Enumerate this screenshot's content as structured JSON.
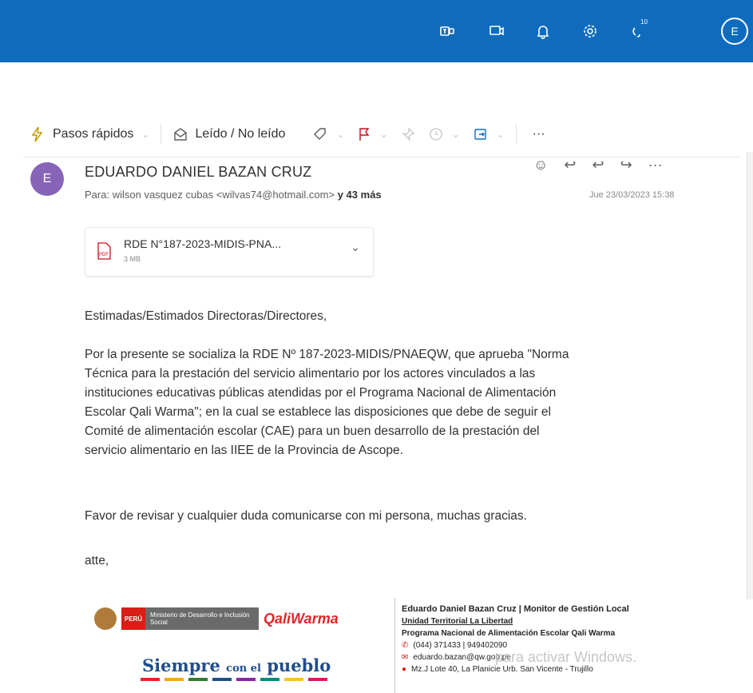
{
  "topbar": {
    "icons": [
      "teams-icon",
      "meet-now-icon",
      "bell-icon",
      "gear-icon",
      "tips-icon"
    ],
    "tips_badge": "10",
    "avatar_initial": "E"
  },
  "toolbar": {
    "quick_steps": "Pasos rápidos",
    "read_unread": "Leído / No leído",
    "more": "···"
  },
  "email": {
    "sender_initial": "E",
    "sender": "EDUARDO DANIEL BAZAN CRUZ",
    "to_prefix": "Para:",
    "to_value": "wilson vasquez cubas <wilvas74@hotmail.com>",
    "to_more": "y 43 más",
    "date": "Jue 23/03/2023 15:38",
    "attachment_name": "RDE N°187-2023-MIDIS-PNA...",
    "attachment_size": "3 MB",
    "greeting": "Estimadas/Estimados Directoras/Directores,",
    "paragraph_lines": [
      "Por la presente se socializa la RDE Nº 187-2023-MIDIS/PNAEQW, que aprueba \"Norma",
      "Técnica para la prestación del servicio alimentario por los actores vinculados a las",
      "instituciones educativas públicas atendidas por el Programa Nacional de Alimentación",
      "Escolar Qali Warma\"; en la cual se establece las disposiciones que debe de seguir el",
      "Comité de alimentación escolar (CAE) para un buen desarrollo de la prestación del",
      "servicio alimentario en las IIEE de la Provincia de Ascope."
    ],
    "closing": "Favor de revisar y cualquier duda comunicarse con mi persona, muchas gracias.",
    "signoff": "atte,"
  },
  "signature": {
    "peru": "PERÚ",
    "ministry": "Ministerio de Desarrollo e Inclusión Social",
    "brand": "QaliWarma",
    "slogan_a": "Siempre",
    "slogan_b": "con el",
    "slogan_c": "pueblo",
    "line1": "Eduardo Daniel Bazan Cruz | Monitor de Gestión Local",
    "line2": "Unidad Territorial La Libertad",
    "line3": "Programa Nacional de Alimentación Escolar Qali Warma",
    "phone": "(044) 371433 | 949402090",
    "email": "eduardo.bazan@qw.gob.pe",
    "address": "Mz.J Lote 40, La Planicie Urb. San Vicente - Trujillo",
    "stripe_colors": [
      "#e3262b",
      "#f5a623",
      "#2e7d32",
      "#1f4e8c",
      "#8e24aa",
      "#00897b",
      "#fbc02d",
      "#d81b60"
    ]
  },
  "watermark": "para activar Windows."
}
